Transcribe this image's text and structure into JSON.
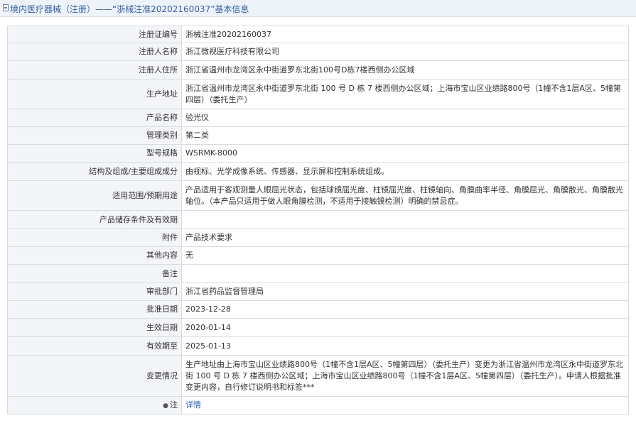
{
  "header": {
    "title": "境内医疗器械（注册）——“浙械注准20202160037”基本信息"
  },
  "rows": [
    {
      "label": "注册证编号",
      "value": "浙械注准20202160037"
    },
    {
      "label": "注册人名称",
      "value": "浙江微视医疗科技有限公司"
    },
    {
      "label": "注册人住所",
      "value": "浙江省温州市龙湾区永中街道罗东北街100号D栋7楼西侧办公区域"
    },
    {
      "label": "生产地址",
      "value": "浙江省温州市龙湾区永中街道罗东北街 100 号 D 栋 7 楼西侧办公区域；上海市宝山区业绩路800号（1幢不含1层A区、5幢第四层）（委托生产）"
    },
    {
      "label": "产品名称",
      "value": "验光仪"
    },
    {
      "label": "管理类别",
      "value": "第二类"
    },
    {
      "label": "型号规格",
      "value": "WSRMK-8000"
    },
    {
      "label": "结构及组成/主要组成成分",
      "value": "由视标、光学成像系统、传感器、显示屏和控制系统组成。"
    },
    {
      "label": "适用范围/预期用途",
      "value": "产品适用于客观测量人眼屈光状态，包括球镜屈光度、柱镜屈光度、柱镜轴向、角膜曲率半径、角膜屈光、角膜散光、角膜散光轴位。（本产品只适用于做人眼角膜检测，不适用于接触镜检测）明确的禁忌症。"
    },
    {
      "label": "产品储存条件及有效期",
      "value": ""
    },
    {
      "label": "附件",
      "value": "产品技术要求"
    },
    {
      "label": "其他内容",
      "value": "无"
    },
    {
      "label": "备注",
      "value": ""
    },
    {
      "label": "审批部门",
      "value": "浙江省药品监督管理局"
    },
    {
      "label": "批准日期",
      "value": "2023-12-28"
    },
    {
      "label": "生效日期",
      "value": "2020-01-14"
    },
    {
      "label": "有效期至",
      "value": "2025-01-13"
    },
    {
      "label": "变更情况",
      "value": "生产地址由上海市宝山区业绩路800号（1幢不含1层A区、5幢第四层）（委托生产）变更为浙江省温州市龙湾区永中街道罗东北街 100 号 D 栋 7 楼西侧办公区域；上海市宝山区业绩路800号（1幢不含1层A区、5幢第四层）（委托生产）。申请人根据批准变更内容，自行修订说明书和标签***"
    }
  ],
  "note": {
    "label": "注",
    "link": "详情"
  }
}
